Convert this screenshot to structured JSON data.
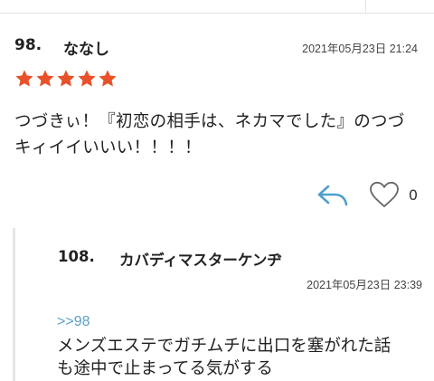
{
  "comment": {
    "number": "98.",
    "name": "ななし",
    "date": "2021年05月23日 21:24",
    "rating": 5,
    "rating_max": 5,
    "star_color": "#e8512a",
    "line1": "つづきぃ！『初恋の相手は、ネカマでした』のつづ",
    "line2": "キィイイいいい！！！！",
    "like_count": "0",
    "icons": {
      "reply": "reply-arrow-icon",
      "like": "heart-outline-icon"
    }
  },
  "reply": {
    "number": "108.",
    "name": "カバディマスターケンヂ",
    "date": "2021年05月23日 23:39",
    "anchor": ">>98",
    "anchor_color": "#5aa0c8",
    "line1": "メンズエステでガチムチに出口を塞がれた話",
    "line2": "も途中で止まってる気がする"
  }
}
